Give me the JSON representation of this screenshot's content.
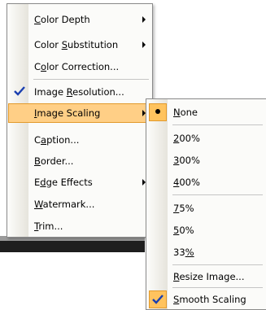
{
  "main_menu": {
    "items": [
      {
        "pre": "",
        "u": "C",
        "post": "olor Depth",
        "submenu": true
      },
      {
        "pre": "Color ",
        "u": "S",
        "post": "ubstitution",
        "submenu": true
      },
      {
        "pre": "C",
        "u": "o",
        "post": "lor Correction...",
        "submenu": false
      },
      {
        "pre": "Image ",
        "u": "R",
        "post": "esolution...",
        "submenu": false,
        "checked": true
      },
      {
        "pre": "",
        "u": "I",
        "post": "mage Scaling",
        "submenu": true,
        "highlighted": true
      },
      {
        "pre": "C",
        "u": "a",
        "post": "ption...",
        "submenu": false
      },
      {
        "pre": "",
        "u": "B",
        "post": "order...",
        "submenu": false
      },
      {
        "pre": "E",
        "u": "d",
        "post": "ge Effects",
        "submenu": true
      },
      {
        "pre": "",
        "u": "W",
        "post": "atermark...",
        "submenu": false
      },
      {
        "pre": "",
        "u": "T",
        "post": "rim...",
        "submenu": false
      }
    ]
  },
  "sub_menu": {
    "items": [
      {
        "pre": "",
        "u": "N",
        "post": "one",
        "selected": true
      },
      {
        "pre": "",
        "u": "2",
        "post": "00%"
      },
      {
        "pre": "",
        "u": "3",
        "post": "00%"
      },
      {
        "pre": "",
        "u": "4",
        "post": "00%"
      },
      {
        "pre": "",
        "u": "7",
        "post": "5%"
      },
      {
        "pre": "",
        "u": "5",
        "post": "0%"
      },
      {
        "pre": "33",
        "u": "%",
        "post": ""
      },
      {
        "pre": "",
        "u": "R",
        "post": "esize Image..."
      },
      {
        "pre": "",
        "u": "S",
        "post": "mooth Scaling",
        "checked": true
      }
    ]
  },
  "colors": {
    "highlight": "#ffcf86",
    "highlight_border": "#e29a2c",
    "check_bg": "#ffc35e"
  }
}
